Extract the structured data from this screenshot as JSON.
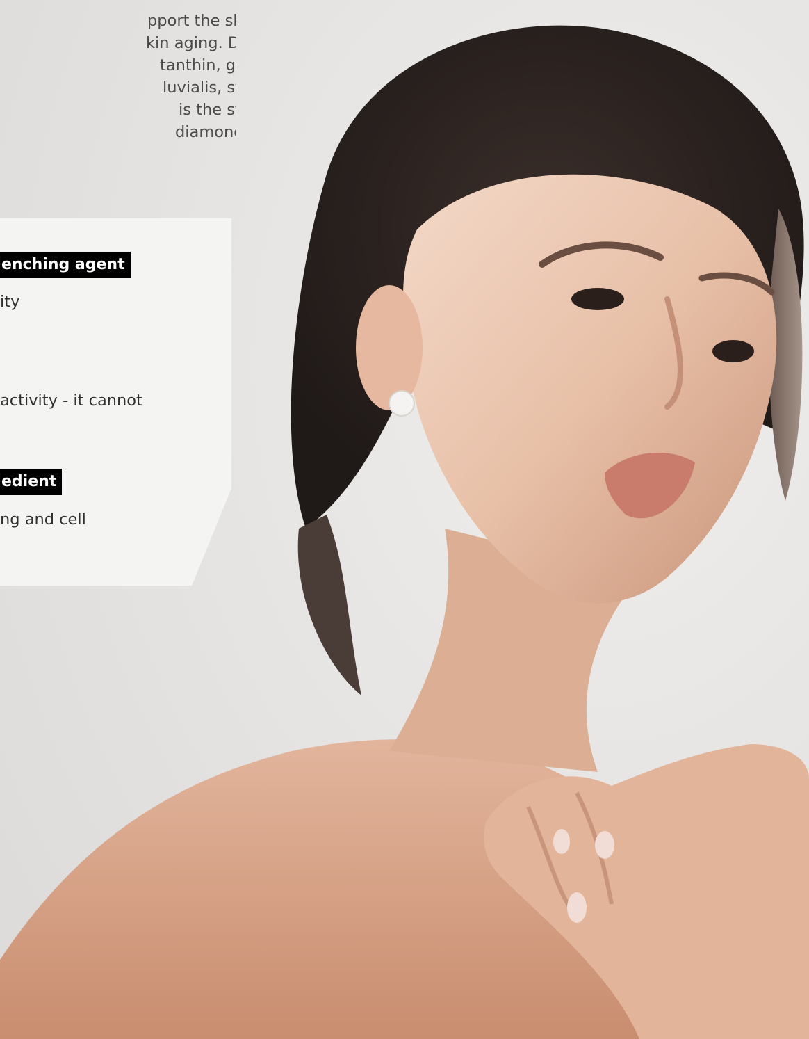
{
  "intro_lines": [
    "pport the skin by neutrali-",
    "kin aging. Due to its unique",
    "tanthin, gained from the",
    "luvialis, stands out from",
    "is the strongest anti-",
    "diamond amongst radical"
  ],
  "panel": {
    "tag_1": "enching agent",
    "text_1": "ity",
    "text_2": "activity - it cannot",
    "tag_2": "edient",
    "text_3": "ng and cell"
  },
  "colors": {
    "background": "#e9e8e6",
    "panel": "#f4f4f3",
    "tag_background": "#000000",
    "tag_text": "#ffffff",
    "body_text": "#303030"
  }
}
